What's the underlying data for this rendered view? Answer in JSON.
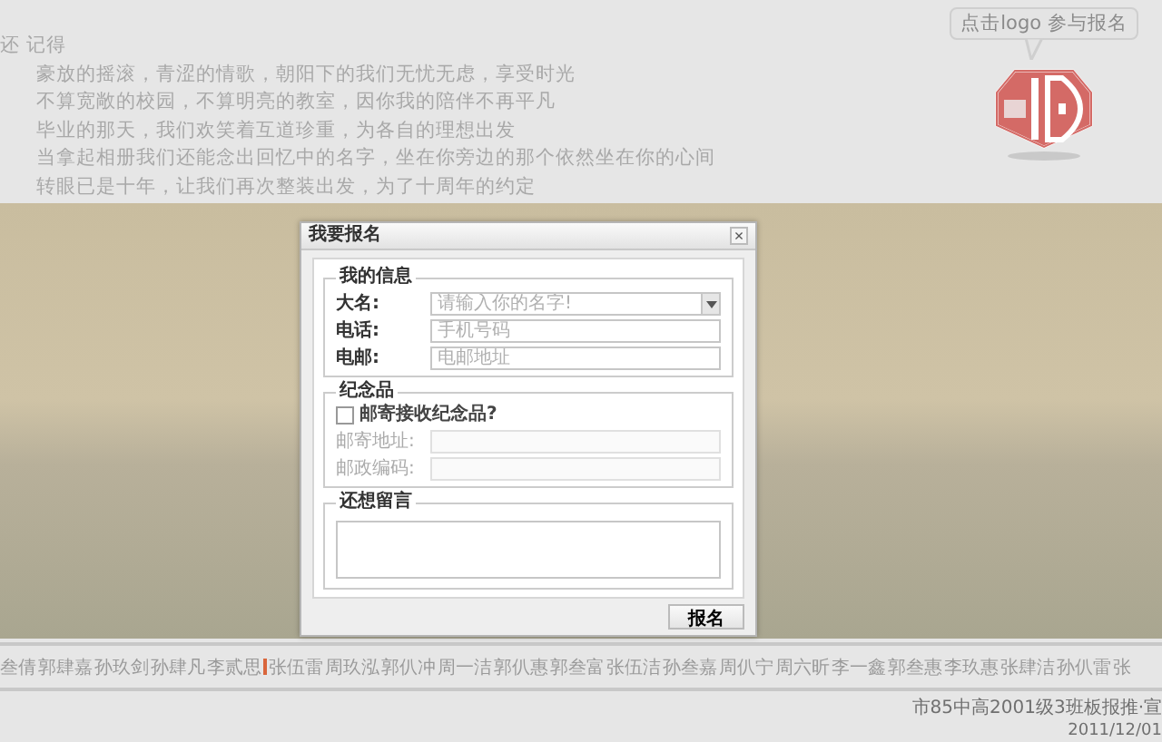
{
  "intro": {
    "heading": "还 记得",
    "lines": [
      "豪放的摇滚，青涩的情歌，朝阳下的我们无忧无虑，享受时光",
      "不算宽敞的校园，不算明亮的教室，因你我的陪伴不再平凡",
      "毕业的那天，我们欢笑着互道珍重，为各自的理想出发",
      "当拿起相册我们还能念出回忆中的名字，坐在你旁边的那个依然坐在你的心间",
      "转眼已是十年，让我们再次整装出发，为了十周年的约定"
    ]
  },
  "logo_hint": "点击logo 参与报名",
  "dialog": {
    "title": "我要报名",
    "close": "×",
    "sections": [
      {
        "legend": "我的信息",
        "fields": [
          {
            "label": "大名:",
            "placeholder": "请输入你的名字!",
            "kind": "dropdown",
            "disabled": false
          },
          {
            "label": "电话:",
            "placeholder": "手机号码",
            "kind": "text",
            "disabled": false
          },
          {
            "label": "电邮:",
            "placeholder": "电邮地址",
            "kind": "text",
            "disabled": false
          }
        ]
      },
      {
        "legend": "纪念品",
        "checkbox": {
          "label": "邮寄接收纪念品?",
          "checked": false
        },
        "fields": [
          {
            "label": "邮寄地址:",
            "kind": "text",
            "disabled": true
          },
          {
            "label": "邮政编码:",
            "kind": "text",
            "disabled": true
          }
        ]
      },
      {
        "legend": "还想留言",
        "fields": [
          {
            "kind": "textarea",
            "disabled": false
          }
        ]
      }
    ],
    "submit": "报名"
  },
  "names": [
    {
      "name": "叁倩",
      "marked": false
    },
    {
      "name": "郭肆嘉",
      "marked": false
    },
    {
      "name": "孙玖剑",
      "marked": false
    },
    {
      "name": "孙肆凡",
      "marked": false
    },
    {
      "name": "李贰思",
      "marked": false
    },
    {
      "name": "张伍雷",
      "marked": true
    },
    {
      "name": "周玖泓",
      "marked": false
    },
    {
      "name": "郭仈冲",
      "marked": false
    },
    {
      "name": "周一洁",
      "marked": false
    },
    {
      "name": "郭仈惠",
      "marked": false
    },
    {
      "name": "郭叁富",
      "marked": false
    },
    {
      "name": "张伍洁",
      "marked": false
    },
    {
      "name": "孙叁嘉",
      "marked": false
    },
    {
      "name": "周仈宁",
      "marked": false
    },
    {
      "name": "周六昕",
      "marked": false
    },
    {
      "name": "李一鑫",
      "marked": false
    },
    {
      "name": "郭叁惠",
      "marked": false
    },
    {
      "name": "李玖惠",
      "marked": false
    },
    {
      "name": "张肆洁",
      "marked": false
    },
    {
      "name": "孙仈雷",
      "marked": false
    },
    {
      "name": "张",
      "marked": false
    }
  ],
  "footer": {
    "title": "市85中高2001级3班板报推·宣",
    "date": "2011/12/01"
  }
}
